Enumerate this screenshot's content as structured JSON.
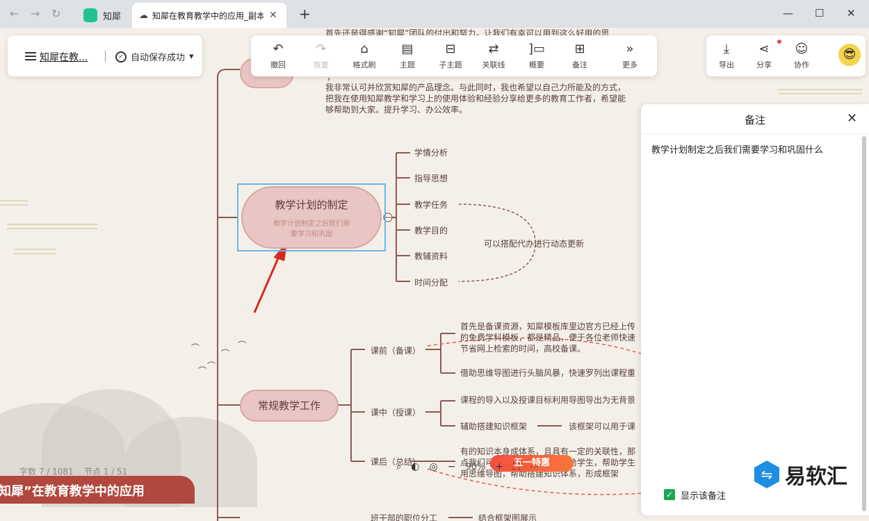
{
  "browser": {
    "tab_inactive": "知犀",
    "tab_active_title": "知犀在教育教学中的应用_副本",
    "tab_close": "✕",
    "new_tab": "+",
    "nav": {
      "back": "←",
      "forward": "→",
      "reload": "↻"
    },
    "window": {
      "minimize": "—",
      "maximize": "☐",
      "close": "✕"
    }
  },
  "header": {
    "doc_title": "知犀在教...",
    "save_status": "自动保存成功",
    "save_dropdown": "▾"
  },
  "toolbar": [
    {
      "label": "撤回",
      "icon": "↶",
      "disabled": false
    },
    {
      "label": "恢复",
      "icon": "↷",
      "disabled": true
    },
    {
      "label": "格式刷",
      "icon": "⌂",
      "disabled": false
    },
    {
      "label": "主题",
      "icon": "▤",
      "disabled": false
    },
    {
      "label": "子主题",
      "icon": "⊟",
      "disabled": false
    },
    {
      "label": "关联线",
      "icon": "⇄",
      "disabled": false
    },
    {
      "label": "概要",
      "icon": "]▭",
      "disabled": false
    },
    {
      "label": "备注",
      "icon": "⊞",
      "disabled": false
    },
    {
      "label": "更多",
      "icon": "»",
      "disabled": false
    }
  ],
  "right_tools": [
    {
      "label": "导出",
      "icon": "⤓"
    },
    {
      "label": "分享",
      "icon": "⋖"
    },
    {
      "label": "协作",
      "icon": "☺"
    }
  ],
  "avatar_icon": "😎",
  "mindmap": {
    "top_partial_text": "首先还是得感谢“知犀”团队的付出和努力，让我们有幸可以用到这么好用的思",
    "intro_paragraph": "我非常认可并欣赏知犀的产品理念。与此同时，我也希望以自己力所能及的方式，把我在使用知犀教学和学习上的使用体验和经验分享给更多的教育工作者，希望能够帮助到大家。提升学习、办公效率。",
    "stray_char": "，",
    "selected_topic": {
      "title": "教学计划的制定",
      "note_preview": "教学计划制定之后我们需要学习和巩固"
    },
    "subtopics": [
      "学情分析",
      "指导思想",
      "教学任务",
      "教学目的",
      "教辅资料",
      "时间分配"
    ],
    "summary_note": "可以搭配代办进行动态更新",
    "routine_topic": "常规教学工作",
    "routine_children": [
      "课前（备课）",
      "课中（授课）",
      "课后（总结）"
    ],
    "before_class_p1": "首先是备课资源，知犀模板库里边官方已经上传的免费学科模板，都是精品，便于各位老师快速节省网上检索的时间，高校备课。",
    "before_class_p2": "借助思维导图进行头脑风暴，快速罗列出课程重",
    "in_class_p1": "课程的导入以及授课目标利用导图导出为无背景",
    "in_class_p2": "辅助搭建知识框架",
    "in_class_p2_child": "该框架可以用于课",
    "after_class": "有的知识本身成体系，且具有一定的关联性，那点我们可以用知犀的方式展示给学生，帮助学生用思维导图，帮助搭建知识体系，形成框架",
    "bottom_topic": "班干部的职位分工",
    "bottom_topic_child": "结合框架图展示"
  },
  "notes_panel": {
    "title": "备注",
    "close": "✕",
    "content": "教学计划制定之后我们需要学习和巩固什么",
    "show_note_label": "显示该备注",
    "show_note_checked": true
  },
  "footer": {
    "word_count": "字数 7 / 1081",
    "node_count": "节点 1 / 51",
    "zoom": "90%",
    "zoom_icons": {
      "search": "🔍",
      "theme": "◐",
      "nav": "◎",
      "minus": "−",
      "plus": "+",
      "fit": "⛶",
      "more": "⋯"
    },
    "promo": "五一特惠",
    "banner": "知犀”在教育教学中的应用",
    "brand": "易软汇",
    "brand_logo": "⇋"
  }
}
